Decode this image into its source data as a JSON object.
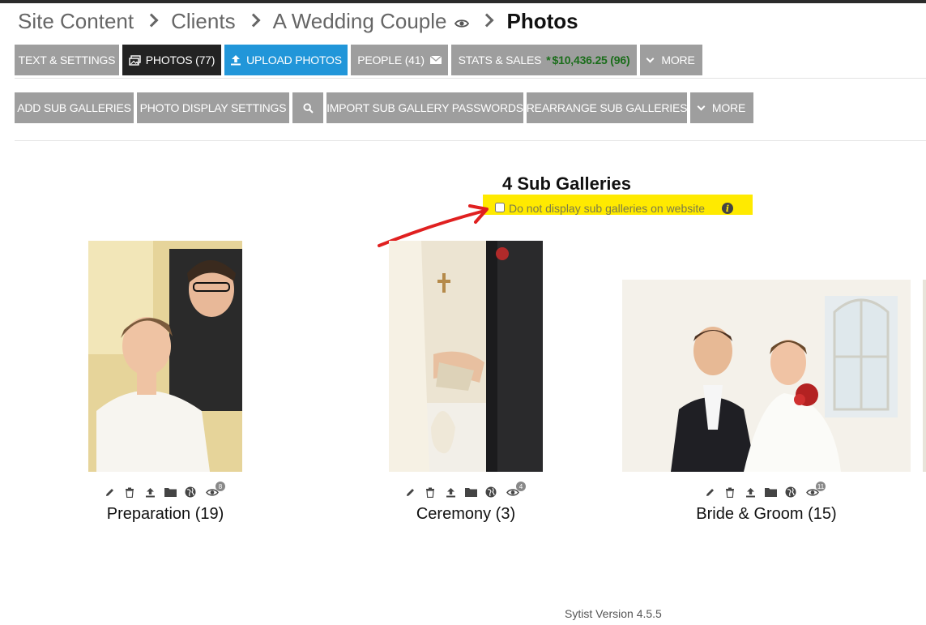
{
  "breadcrumb": {
    "items": [
      "Site Content",
      "Clients",
      "A Wedding Couple"
    ],
    "current": "Photos"
  },
  "toolbar1": {
    "text_settings": "TEXT & SETTINGS",
    "photos": "PHOTOS (77)",
    "upload_photos": "UPLOAD PHOTOS",
    "people": "PEOPLE (41)",
    "stats_sales": "STATS & SALES",
    "sales_star": "*",
    "sales_amount": "$10,436.25 (96)",
    "more": "MORE"
  },
  "toolbar2": {
    "add_sub_galleries": "ADD SUB GALLERIES",
    "photo_display_settings": "PHOTO DISPLAY SETTINGS",
    "import_passwords": "IMPORT SUB GALLERY PASSWORDS",
    "rearrange": "REARRANGE SUB GALLERIES",
    "more": "MORE"
  },
  "sub_galleries": {
    "heading": "4 Sub Galleries",
    "hide_option_label": "Do not display sub galleries on website",
    "hide_option_checked": false,
    "items": [
      {
        "caption": "Preparation (19)",
        "views": "8"
      },
      {
        "caption": "Ceremony (3)",
        "views": "4"
      },
      {
        "caption": "Bride & Groom (15)",
        "views": "11"
      }
    ]
  },
  "footer": {
    "version": "Sytist Version 4.5.5"
  },
  "colors": {
    "button_gray": "#9e9e9e",
    "button_dark": "#232323",
    "button_blue": "#2196d9",
    "sales_green": "#1b6d1b",
    "highlight_yellow": "#ffea00",
    "annotation_arrow": "#e02020"
  },
  "icons": {
    "breadcrumb_separator": "chevron-right-icon",
    "breadcrumb_view": "eye-icon",
    "photos": "photos-icon",
    "upload": "upload-icon",
    "people": "envelope-icon",
    "search": "search-icon",
    "more": "chevron-down-icon",
    "info": "info-icon",
    "gallery_actions": [
      "pencil-icon",
      "trash-icon",
      "upload-icon",
      "folder-icon",
      "globe-icon",
      "eye-icon"
    ]
  }
}
